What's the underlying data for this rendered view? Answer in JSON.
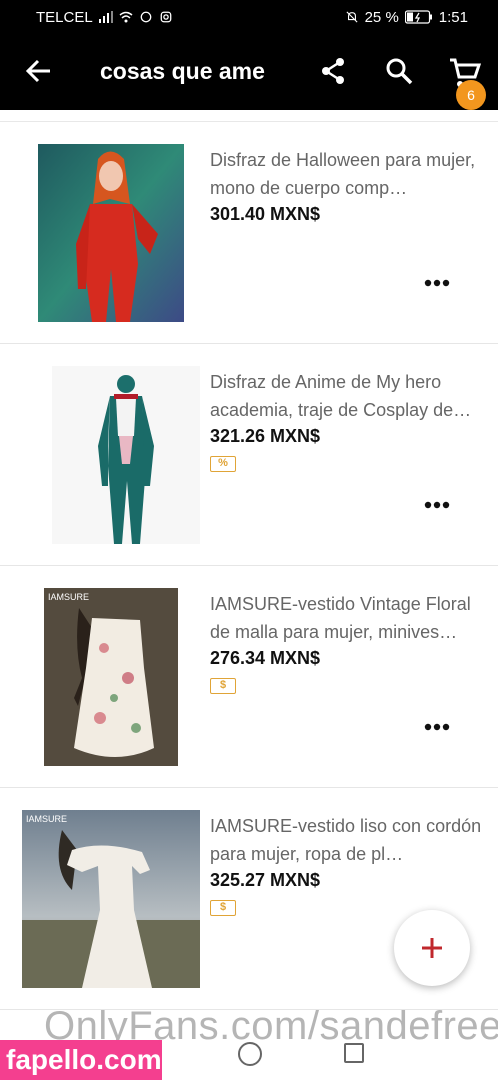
{
  "status_bar": {
    "carrier": "TELCEL",
    "battery": "25 %",
    "time": "1:51"
  },
  "app_bar": {
    "title": "cosas que ame",
    "cart_count": "6",
    "icons": [
      "back-arrow-icon",
      "share-icon",
      "search-icon",
      "cart-icon"
    ]
  },
  "items": [
    {
      "name": "Disfraz de Halloween para mujer, mono de cuerpo comp…",
      "price": "301.40 MXN$",
      "tag": ""
    },
    {
      "name": "Disfraz de Anime de My hero academia, traje de Cosplay de…",
      "price": "321.26 MXN$",
      "tag": "%"
    },
    {
      "name": "IAMSURE-vestido Vintage Floral de malla para mujer, minives…",
      "price": "276.34 MXN$",
      "tag": "$",
      "brand": "IAMSURE"
    },
    {
      "name": "IAMSURE-vestido liso con cordón para mujer, ropa de pl…",
      "price": "325.27 MXN$",
      "tag": "$",
      "brand": "IAMSURE"
    }
  ],
  "fab": {
    "label": "+"
  },
  "watermark": "OnlyFans.com/sandefree",
  "overlay_label": "fapello.com",
  "colors": {
    "accent": "#f2961e",
    "fab_plus": "#c0282d",
    "tag": "#e0a437"
  }
}
